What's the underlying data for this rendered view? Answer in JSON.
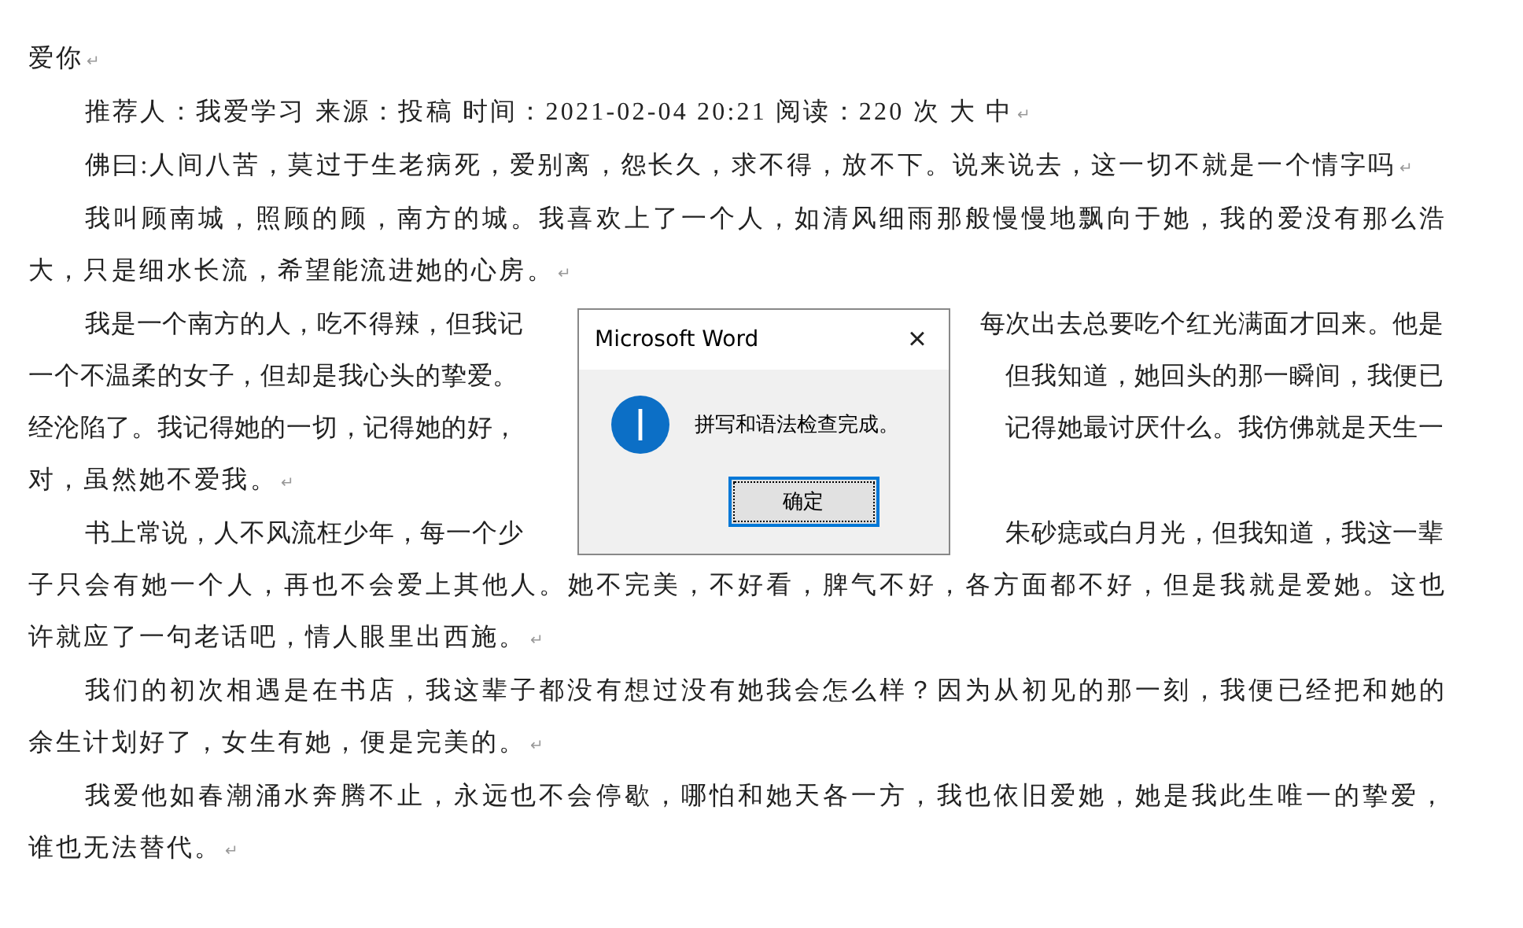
{
  "document": {
    "paragraphs": [
      {
        "indent": false,
        "lines": [
          {
            "left": "爱你"
          }
        ],
        "end_mark": "↵"
      },
      {
        "indent": true,
        "lines": [
          {
            "left": "推荐人：我爱学习 来源：投稿 时间：2021-02-04 20:21 阅读：220 次 大 中"
          }
        ],
        "end_mark": "↵"
      },
      {
        "indent": true,
        "lines": [
          {
            "left": "佛曰:人间八苦，莫过于生老病死，爱别离，怨长久，求不得，放不下。说来说去，这一切不就是一个情字吗"
          }
        ],
        "end_mark": "↵"
      },
      {
        "indent": true,
        "lines": [
          {
            "left": "我叫顾南城，照顾的顾，南方的城。我喜欢上了一个人，如清风细雨那般慢慢地飘向于她，我的爱没有那么浩"
          },
          {
            "left": "大，只是细水长流，希望能流进她的心房。"
          }
        ],
        "end_mark": "↵"
      },
      {
        "indent": true,
        "lines": [
          {
            "left": "我是一个南方的人，吃不得辣，但我记",
            "right": "每次出去总要吃个红光满面才回来。他是"
          },
          {
            "left": "一个不温柔的女子，但却是我心头的挚爱。",
            "right": "但我知道，她回头的那一瞬间，我便已"
          },
          {
            "left": "经沦陷了。我记得她的一切，记得她的好，",
            "right": "记得她最讨厌什么。我仿佛就是天生一"
          },
          {
            "left": "对，虽然她不爱我。"
          }
        ],
        "end_mark": "↵"
      },
      {
        "indent": true,
        "lines": [
          {
            "left": "书上常说，人不风流枉少年，每一个少",
            "right": "朱砂痣或白月光，但我知道，我这一辈"
          },
          {
            "left": "子只会有她一个人，再也不会爱上其他人。她不完美，不好看，脾气不好，各方面都不好，但是我就是爱她。这也"
          },
          {
            "left": "许就应了一句老话吧，情人眼里出西施。"
          }
        ],
        "end_mark": "↵"
      },
      {
        "indent": true,
        "lines": [
          {
            "left": "我们的初次相遇是在书店，我这辈子都没有想过没有她我会怎么样？因为从初见的那一刻，我便已经把和她的"
          },
          {
            "left": "余生计划好了，女生有她，便是完美的。"
          }
        ],
        "end_mark": "↵"
      },
      {
        "indent": true,
        "lines": [
          {
            "left": "我爱他如春潮涌水奔腾不止，永远也不会停歇，哪怕和她天各一方，我也依旧爱她，她是我此生唯一的挚爱，"
          },
          {
            "left": "谁也无法替代。"
          }
        ],
        "end_mark": "↵"
      }
    ]
  },
  "dialog": {
    "title": "Microsoft Word",
    "close": "×",
    "message": "拼写和语法检查完成。",
    "button": {
      "label": "确定",
      "focused": true
    }
  }
}
